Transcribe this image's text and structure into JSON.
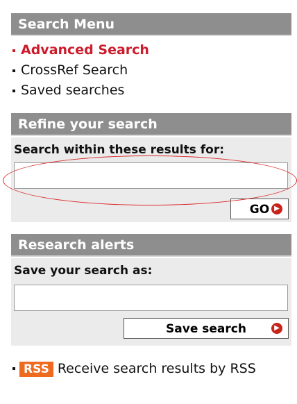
{
  "search_menu": {
    "title": "Search Menu",
    "items": [
      {
        "label": "Advanced Search",
        "active": true
      },
      {
        "label": "CrossRef Search",
        "active": false
      },
      {
        "label": "Saved searches",
        "active": false
      }
    ]
  },
  "refine": {
    "title": "Refine your search",
    "label": "Search within these results for:",
    "input_value": "",
    "go_label": "GO",
    "go_icon": "arrow-circle-icon"
  },
  "alerts": {
    "title": "Research alerts",
    "label": "Save your search as:",
    "input_value": "",
    "save_label": "Save search",
    "save_icon": "arrow-circle-icon"
  },
  "rss": {
    "badge": "RSS",
    "text": "Receive search results by RSS"
  },
  "colors": {
    "header_bg": "#8e8e8e",
    "active_link": "#cc1b2b",
    "arrow": "#c8241b",
    "rss_badge": "#ee6a1f",
    "annotation": "#d92a2a"
  }
}
